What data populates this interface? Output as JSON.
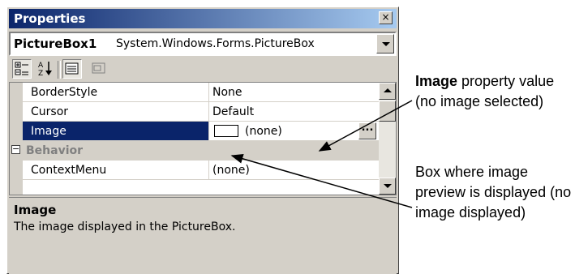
{
  "window": {
    "title": "Properties",
    "close_glyph": "×"
  },
  "object_selector": {
    "name": "PictureBox1",
    "type": "System.Windows.Forms.PictureBox"
  },
  "toolbar": {
    "buttons": [
      {
        "icon": "categorized-icon",
        "pressed": true
      },
      {
        "icon": "alphabetical-icon",
        "pressed": false
      },
      {
        "icon": "properties-icon",
        "pressed": true
      },
      {
        "icon": "events-icon",
        "pressed": false
      }
    ]
  },
  "grid": {
    "rows": [
      {
        "name": "BorderStyle",
        "value": "None"
      },
      {
        "name": "Cursor",
        "value": "Default"
      },
      {
        "name": "Image",
        "value": "(none)",
        "selected": true
      },
      {
        "name": "Behavior",
        "category": true
      },
      {
        "name": "ContextMenu",
        "value": "(none)"
      }
    ],
    "expander_glyph": "−",
    "ellipsis": "..."
  },
  "description": {
    "title": "Image",
    "text": "The image displayed in the PictureBox."
  },
  "annotations": {
    "note1_bold": "Image",
    "note1_rest": " property value (no image selected)",
    "note2": "Box where image preview is displayed (no image displayed)"
  },
  "colors": {
    "titlebar_start": "#0a246a",
    "titlebar_end": "#a6caf0",
    "selection": "#0a246a",
    "face": "#d4d0c8"
  }
}
